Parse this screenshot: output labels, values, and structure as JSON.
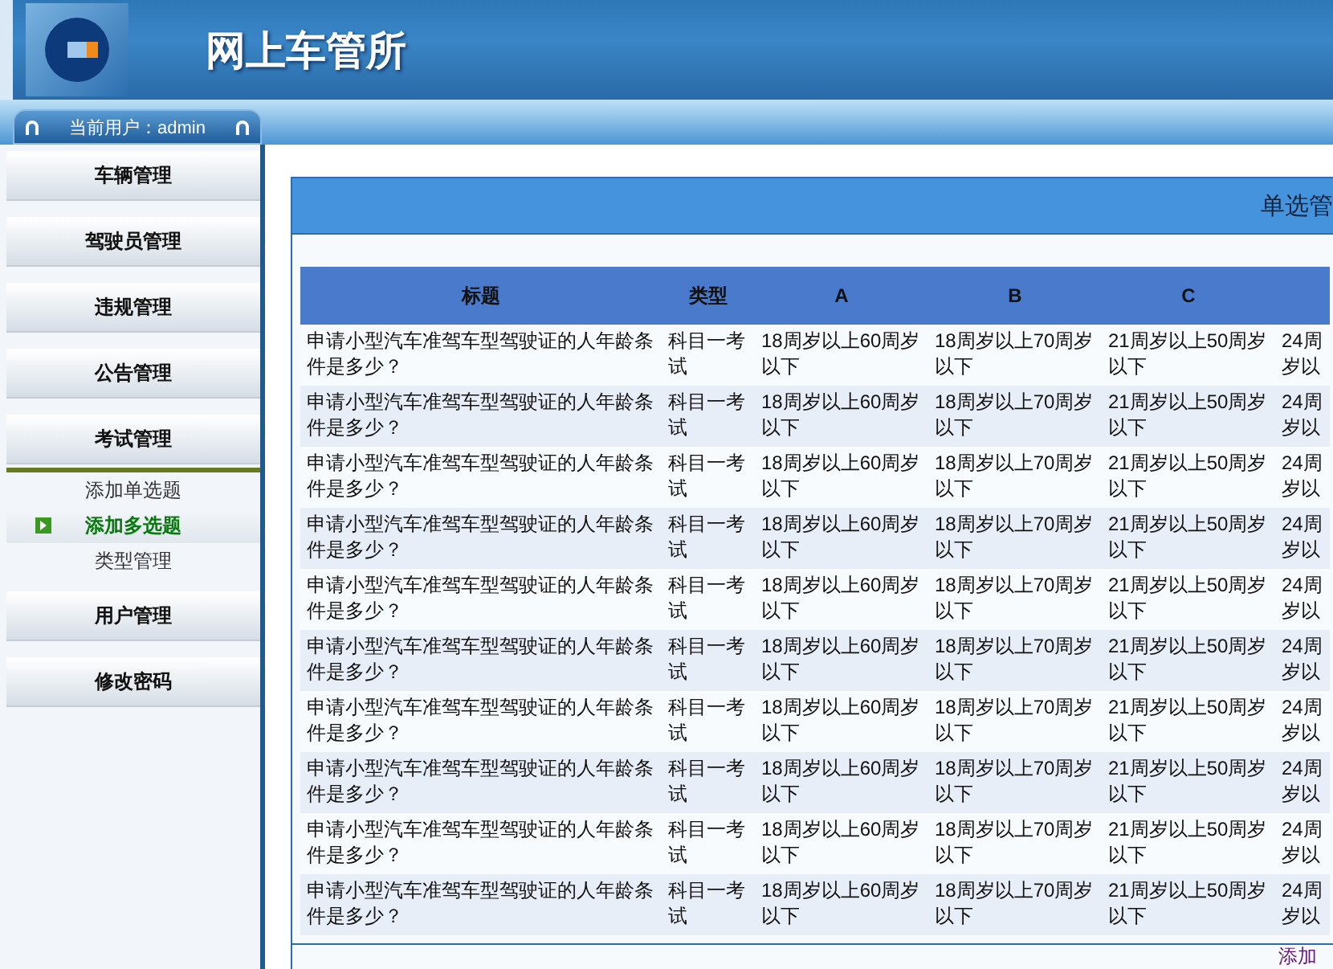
{
  "header": {
    "title": "网上车管所"
  },
  "user_bar": {
    "label": "当前用户：admin"
  },
  "sidebar": {
    "items": [
      {
        "label": "车辆管理"
      },
      {
        "label": "驾驶员管理"
      },
      {
        "label": "违规管理"
      },
      {
        "label": "公告管理"
      },
      {
        "label": "考试管理",
        "children": [
          {
            "label": "添加单选题",
            "selected": false
          },
          {
            "label": "添加多选题",
            "selected": true
          },
          {
            "label": "类型管理",
            "selected": false
          }
        ]
      },
      {
        "label": "用户管理"
      },
      {
        "label": "修改密码"
      }
    ]
  },
  "panel": {
    "title": "单选管",
    "table": {
      "columns": [
        "标题",
        "类型",
        "A",
        "B",
        "C"
      ],
      "rows": [
        [
          "申请小型汽车准驾车型驾驶证的人年龄条件是多少？",
          "科目一考试",
          "18周岁以上60周岁以下",
          "18周岁以上70周岁以下",
          "21周岁以上50周岁以下",
          "24周岁以"
        ],
        [
          "申请小型汽车准驾车型驾驶证的人年龄条件是多少？",
          "科目一考试",
          "18周岁以上60周岁以下",
          "18周岁以上70周岁以下",
          "21周岁以上50周岁以下",
          "24周岁以"
        ],
        [
          "申请小型汽车准驾车型驾驶证的人年龄条件是多少？",
          "科目一考试",
          "18周岁以上60周岁以下",
          "18周岁以上70周岁以下",
          "21周岁以上50周岁以下",
          "24周岁以"
        ],
        [
          "申请小型汽车准驾车型驾驶证的人年龄条件是多少？",
          "科目一考试",
          "18周岁以上60周岁以下",
          "18周岁以上70周岁以下",
          "21周岁以上50周岁以下",
          "24周岁以"
        ],
        [
          "申请小型汽车准驾车型驾驶证的人年龄条件是多少？",
          "科目一考试",
          "18周岁以上60周岁以下",
          "18周岁以上70周岁以下",
          "21周岁以上50周岁以下",
          "24周岁以"
        ],
        [
          "申请小型汽车准驾车型驾驶证的人年龄条件是多少？",
          "科目一考试",
          "18周岁以上60周岁以下",
          "18周岁以上70周岁以下",
          "21周岁以上50周岁以下",
          "24周岁以"
        ],
        [
          "申请小型汽车准驾车型驾驶证的人年龄条件是多少？",
          "科目一考试",
          "18周岁以上60周岁以下",
          "18周岁以上70周岁以下",
          "21周岁以上50周岁以下",
          "24周岁以"
        ],
        [
          "申请小型汽车准驾车型驾驶证的人年龄条件是多少？",
          "科目一考试",
          "18周岁以上60周岁以下",
          "18周岁以上70周岁以下",
          "21周岁以上50周岁以下",
          "24周岁以"
        ],
        [
          "申请小型汽车准驾车型驾驶证的人年龄条件是多少？",
          "科目一考试",
          "18周岁以上60周岁以下",
          "18周岁以上70周岁以下",
          "21周岁以上50周岁以下",
          "24周岁以"
        ],
        [
          "申请小型汽车准驾车型驾驶证的人年龄条件是多少？",
          "科目一考试",
          "18周岁以上60周岁以下",
          "18周岁以上70周岁以下",
          "21周岁以上50周岁以下",
          "24周岁以"
        ]
      ]
    },
    "add_link": "添加"
  }
}
